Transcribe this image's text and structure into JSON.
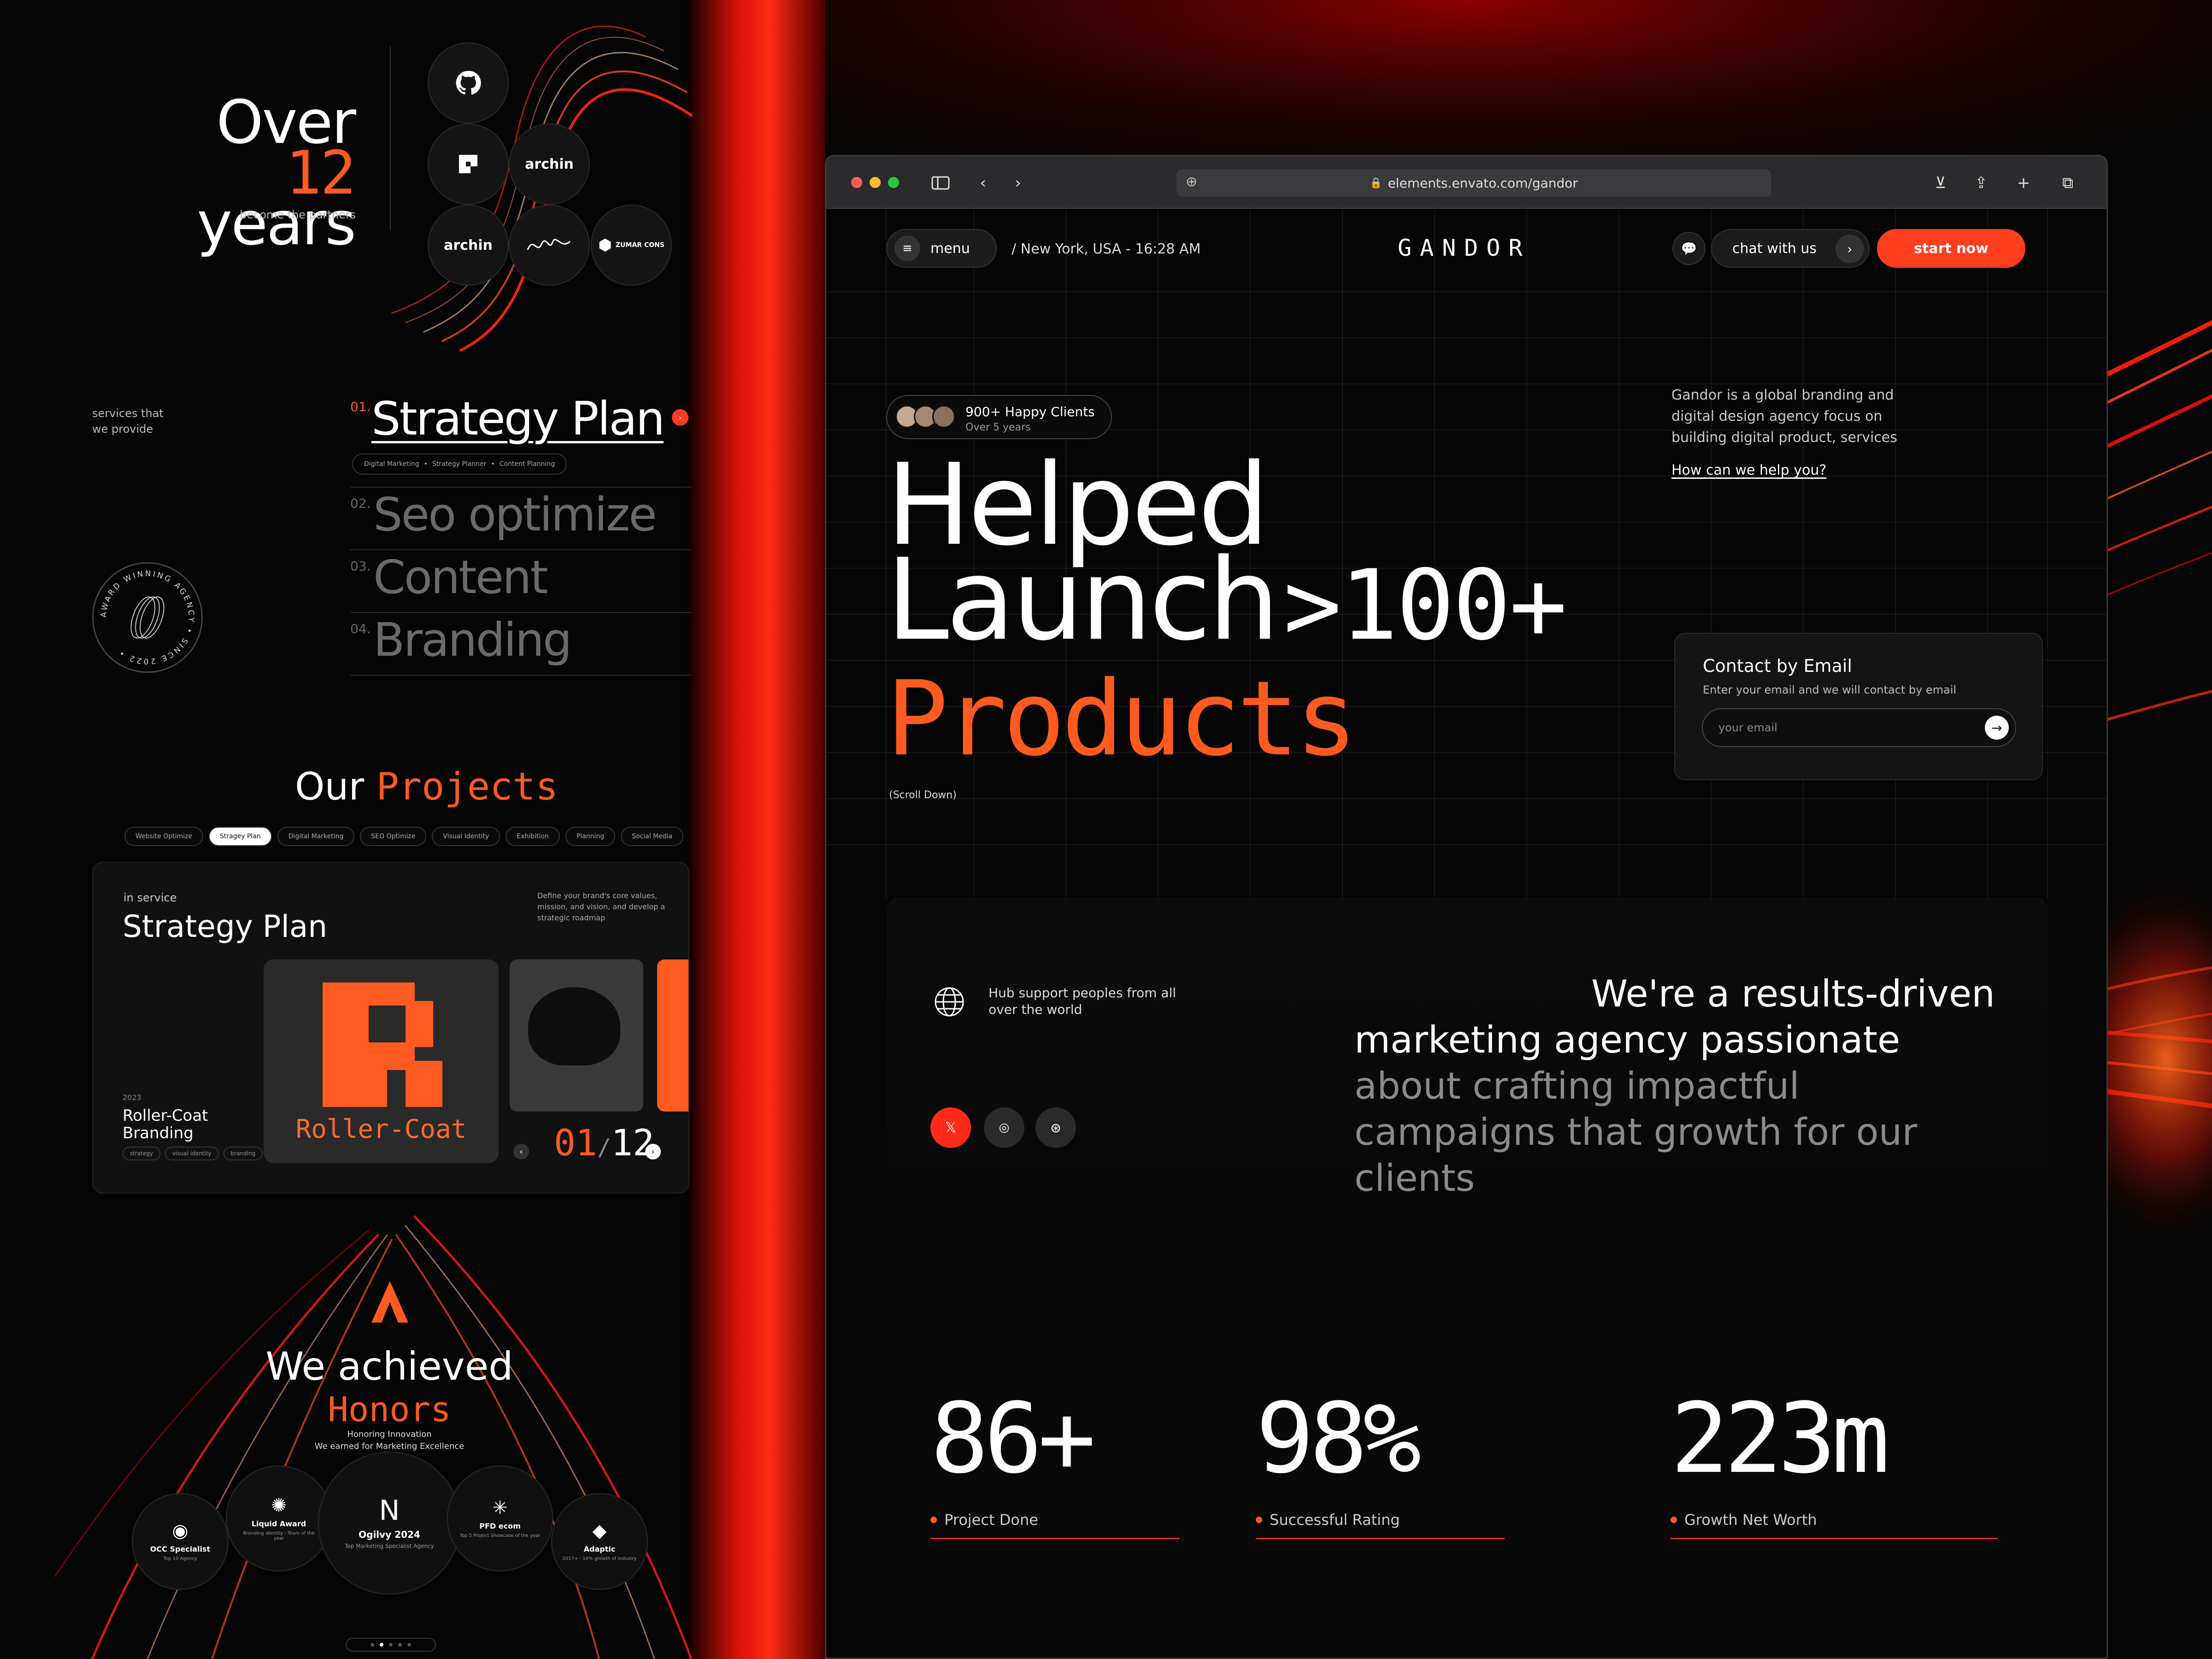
{
  "left": {
    "hero_over": "Over",
    "hero_num": "12",
    "hero_years": "years",
    "partners_sub": "become the partners",
    "partner_logos": [
      "archin",
      "archin",
      "ZUMAR CONS"
    ],
    "services_label_1": "services that",
    "services_label_2": "we provide",
    "services": [
      {
        "num": "01.",
        "label": "Strategy Plan"
      },
      {
        "num": "02.",
        "label": "Seo optimize"
      },
      {
        "num": "03.",
        "label": "Content"
      },
      {
        "num": "04.",
        "label": "Branding"
      }
    ],
    "service_tags": [
      "Digital Marketing",
      "Strategy Planner",
      "Content Planning"
    ],
    "badge_text": "AWARD WINNING AGENCY • SINCE 2022 •",
    "projects_title_1": "Our",
    "projects_title_2": "Projects",
    "project_chips": [
      "Website Optimize",
      "Stragey Plan",
      "Digital Marketing",
      "SEO Optimize",
      "Visual Identity",
      "Exhibition",
      "Planning",
      "Social Media"
    ],
    "card": {
      "in_service": "in service",
      "title": "Strategy Plan",
      "description": "Define your brand's core values, mission, and vision, and develop a strategic roadmap",
      "year": "2023",
      "project_name_1": "Roller-Coat",
      "project_name_2": "Branding",
      "tags": [
        "strategy",
        "visual identity",
        "branding"
      ],
      "logo_word": "Roller-Coat",
      "counter_current": "01",
      "counter_total": "12"
    },
    "achieved_title_1": "We achieved",
    "achieved_title_2": "Honors",
    "achieved_sub_1": "Honoring Innovation",
    "achieved_sub_2": "We earned for Marketing Excellence",
    "honors": [
      {
        "name": "OCC Specialist",
        "sub": "Top 10 Agency"
      },
      {
        "name": "Liquid Award",
        "sub": "Branding identity - Team of the year"
      },
      {
        "name": "Ogilvy 2024",
        "sub": "Top Marketing Specialist Agency"
      },
      {
        "name": "PFD ecom",
        "sub": "Top 5 Project Showcase of the year"
      },
      {
        "name": "Adaptic",
        "sub": "2017+ - 10% growth of industry"
      }
    ]
  },
  "browser": {
    "url": "elements.envato.com/gandor"
  },
  "site": {
    "menu_label": "menu",
    "location": "/  New York, USA - 16:28 AM",
    "brand": "GANDOR",
    "chat_label": "chat with us",
    "start_label": "start now",
    "clients_main": "900+ Happy Clients",
    "clients_sub": "Over 5 years",
    "hero_line1": "Helped",
    "hero_line2": "Launch",
    "hero_gt": ">100+",
    "hero_line3": "Products",
    "scroll": "(Scroll Down)",
    "intro": "Gandor is a global branding and digital design agency focus on building digital product, services",
    "help_link": "How can we help you?",
    "email": {
      "title": "Contact by Email",
      "subtitle": "Enter your email and we will contact by email",
      "placeholder": "your email"
    },
    "support": "Hub support peoples from all over the world",
    "mission_bright": "We're a results-driven marketing agency passionate ",
    "mission_dim": "about crafting impactful campaigns that growth for our clients",
    "stats": [
      {
        "value": "86+",
        "label": "Project Done"
      },
      {
        "value": "98%",
        "label": "Successful Rating"
      },
      {
        "value": "223m",
        "label": "Growth Net Worth"
      }
    ]
  },
  "colors": {
    "accent": "#ff5a1f",
    "cta": "#ff3d1f",
    "background": "#050505"
  }
}
